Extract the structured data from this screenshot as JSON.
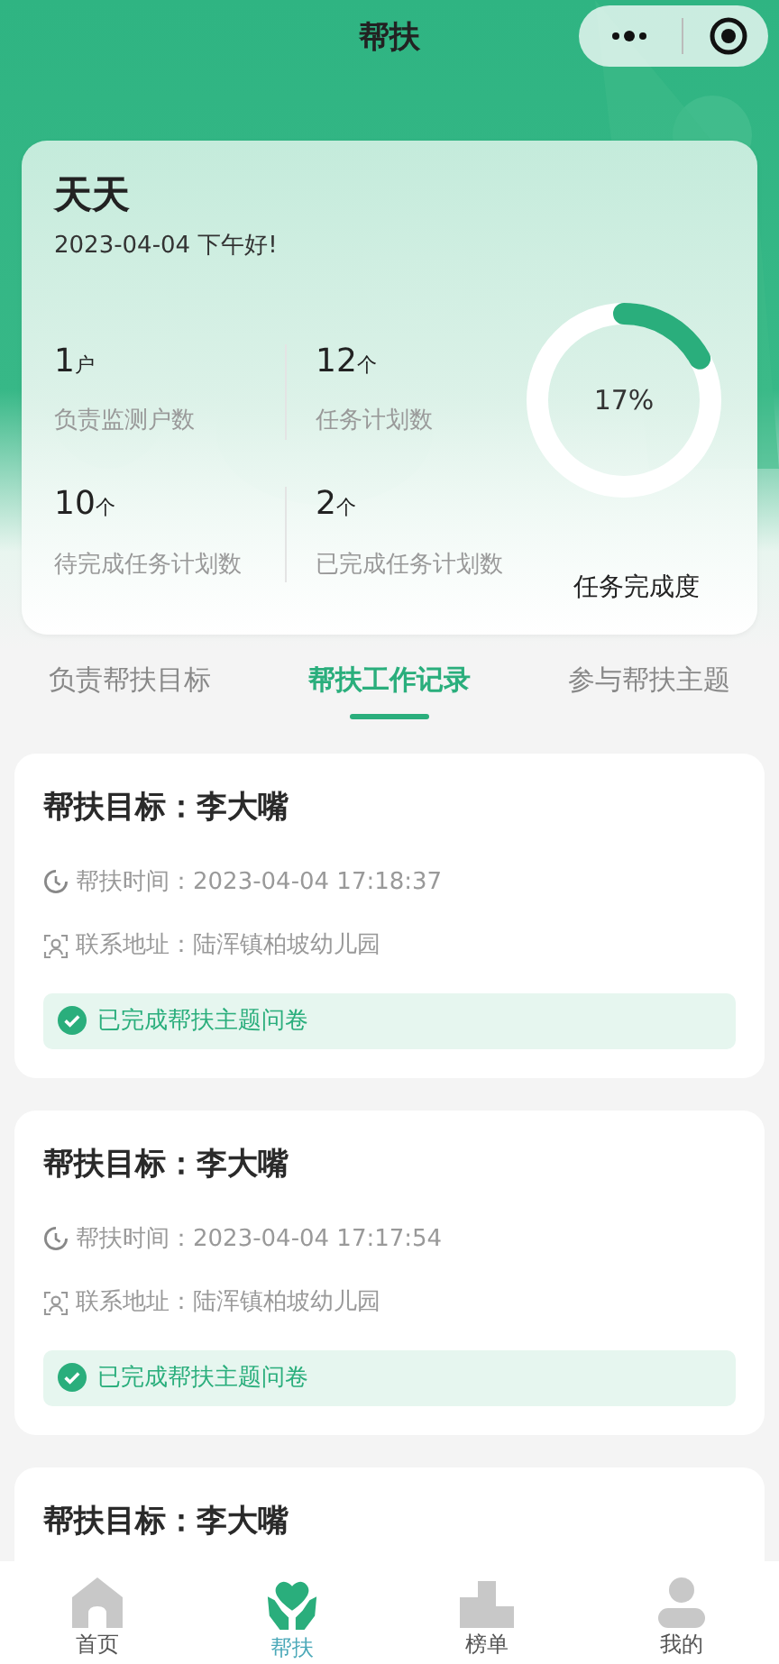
{
  "nav_bar": {
    "title": "帮扶"
  },
  "summary": {
    "name": "天天",
    "greeting": "2023-04-04 下午好!",
    "stats": [
      {
        "value": "1",
        "unit": "户",
        "label": "负责监测户数"
      },
      {
        "value": "12",
        "unit": "个",
        "label": "任务计划数"
      },
      {
        "value": "10",
        "unit": "个",
        "label": "待完成任务计划数"
      },
      {
        "value": "2",
        "unit": "个",
        "label": "已完成任务计划数"
      }
    ],
    "progress": {
      "reading": "17%",
      "label": "任务完成度"
    }
  },
  "tabs": [
    {
      "label": "负责帮扶目标",
      "selected": false
    },
    {
      "label": "帮扶工作记录",
      "selected": true
    },
    {
      "label": "参与帮扶主题",
      "selected": false
    }
  ],
  "records": [
    {
      "title": "帮扶目标：李大嘴",
      "time_label": "帮扶时间：",
      "time": "2023-04-04 17:18:37",
      "address_label": "联系地址：",
      "address": "陆浑镇柏坡幼儿园",
      "status": "已完成帮扶主题问卷"
    },
    {
      "title": "帮扶目标：李大嘴",
      "time_label": "帮扶时间：",
      "time": "2023-04-04 17:17:54",
      "address_label": "联系地址：",
      "address": "陆浑镇柏坡幼儿园",
      "status": "已完成帮扶主题问卷"
    },
    {
      "title": "帮扶目标：李大嘴"
    }
  ],
  "tab_bar": [
    {
      "kind": "home",
      "label": "首页",
      "selected": false
    },
    {
      "kind": "help",
      "label": "帮扶",
      "selected": true
    },
    {
      "kind": "rank",
      "label": "榜单",
      "selected": false
    },
    {
      "kind": "me",
      "label": "我的",
      "selected": false
    }
  ]
}
